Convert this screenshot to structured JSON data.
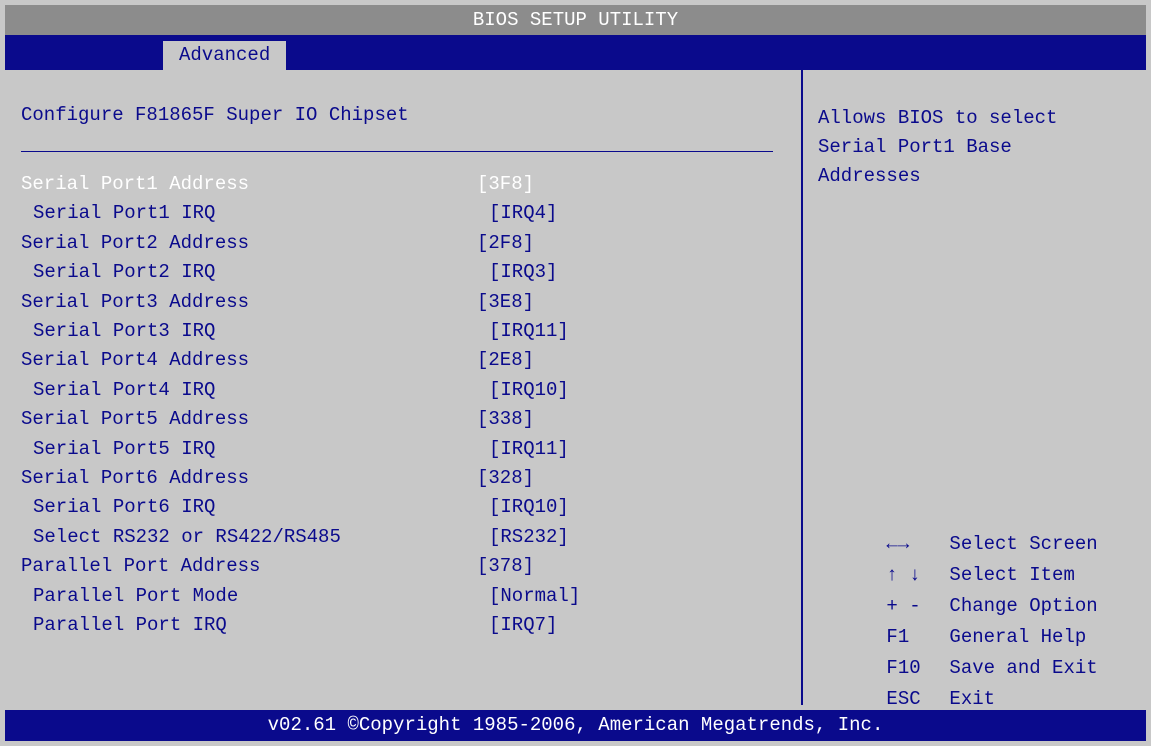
{
  "title": "BIOS SETUP UTILITY",
  "tabs": [
    {
      "label": "Advanced",
      "active": true
    }
  ],
  "main": {
    "heading": "Configure F81865F Super IO Chipset",
    "options": [
      {
        "label": "Serial Port1 Address",
        "value": "[3F8]",
        "selected": true
      },
      {
        "label": "Serial Port1 IRQ",
        "value": "[IRQ4]"
      },
      {
        "label": "Serial Port2 Address",
        "value": "[2F8]"
      },
      {
        "label": "Serial Port2 IRQ",
        "value": "[IRQ3]"
      },
      {
        "label": "Serial Port3 Address",
        "value": "[3E8]"
      },
      {
        "label": "Serial Port3 IRQ",
        "value": "[IRQ11]"
      },
      {
        "label": "Serial Port4 Address",
        "value": "[2E8]"
      },
      {
        "label": "Serial Port4 IRQ",
        "value": "[IRQ10]"
      },
      {
        "label": "Serial Port5 Address",
        "value": "[338]"
      },
      {
        "label": "Serial Port5 IRQ",
        "value": "[IRQ11]"
      },
      {
        "label": "Serial Port6 Address",
        "value": "[328]"
      },
      {
        "label": "Serial Port6 IRQ",
        "value": "[IRQ10]"
      },
      {
        "label": "Select RS232 or RS422/RS485",
        "value": "[RS232]"
      },
      {
        "label": "Parallel Port Address",
        "value": "[378]"
      },
      {
        "label": "Parallel Port Mode",
        "value": "[Normal]"
      },
      {
        "label": "Parallel Port IRQ",
        "value": "[IRQ7]"
      }
    ]
  },
  "help": {
    "lines": [
      "Allows BIOS to select",
      "Serial Port1 Base",
      "Addresses"
    ]
  },
  "keys": [
    {
      "key": "←→",
      "desc": "Select Screen"
    },
    {
      "key": "↑ ↓",
      "desc": "Select Item"
    },
    {
      "key": "+ -",
      "desc": "Change Option"
    },
    {
      "key": "F1",
      "desc": "General Help"
    },
    {
      "key": "F10",
      "desc": "Save and Exit"
    },
    {
      "key": "ESC",
      "desc": "Exit"
    }
  ],
  "footer": "v02.61 ©Copyright 1985-2006, American Megatrends, Inc.",
  "colors": {
    "background": "#c8c8c8",
    "title_bar": "#8c8c8c",
    "accent_blue": "#0a0a8c",
    "highlight_text": "#ffffff"
  }
}
